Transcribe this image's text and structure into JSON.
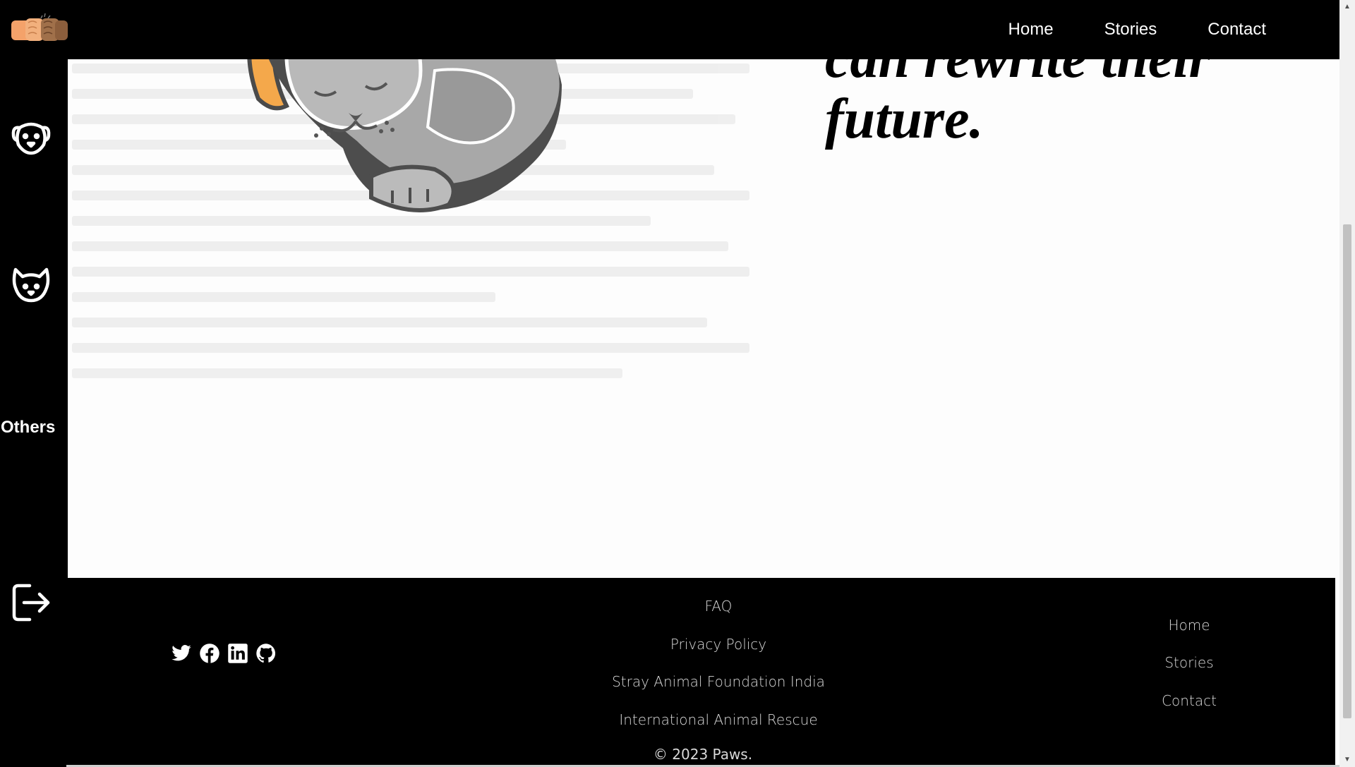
{
  "brand": {
    "logo_icon": "paw-fist-bump-logo"
  },
  "topnav": {
    "items": [
      {
        "label": "Home"
      },
      {
        "label": "Stories"
      },
      {
        "label": "Contact"
      }
    ]
  },
  "sidebar": {
    "items": [
      {
        "icon": "dog-face-icon"
      },
      {
        "icon": "cat-face-icon"
      },
      {
        "label": "Others"
      },
      {
        "icon": "logout-icon"
      }
    ]
  },
  "hero": {
    "tagline_line1": "can rewrite their",
    "tagline_line2": "future."
  },
  "footer": {
    "social": [
      {
        "icon": "twitter-icon"
      },
      {
        "icon": "facebook-icon"
      },
      {
        "icon": "linkedin-icon"
      },
      {
        "icon": "github-icon"
      }
    ],
    "center_links": [
      {
        "label": "FAQ"
      },
      {
        "label": "Privacy Policy"
      },
      {
        "label": "Stray Animal Foundation India"
      },
      {
        "label": "International Animal Rescue"
      }
    ],
    "right_links": [
      {
        "label": "Home"
      },
      {
        "label": "Stories"
      },
      {
        "label": "Contact"
      }
    ],
    "copyright": "© 2023 Paws."
  },
  "colors": {
    "nav_background": "#000000",
    "page_background": "#fdfdfd",
    "footer_text": "#d8d8d8",
    "cat_orange": "#f4a84b",
    "cat_gray": "#a8a8a8"
  }
}
